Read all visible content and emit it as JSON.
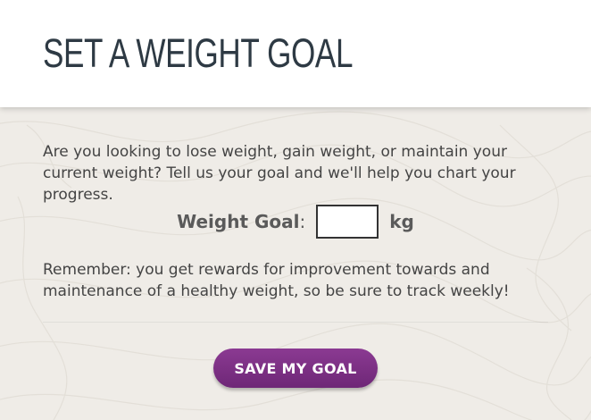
{
  "page": {
    "title": "SET A WEIGHT GOAL"
  },
  "main": {
    "intro_text": "Are you looking to lose weight, gain weight, or maintain your current weight? Tell us your goal and we'll help you chart your progress.",
    "goal_label": "Weight Goal",
    "goal_colon": ":",
    "goal_value": "",
    "goal_placeholder": "",
    "goal_unit": "kg",
    "remember_text": "Remember: you get rewards for improvement towards and maintenance of a healthy weight, so be sure to track weekly!",
    "save_label": "SAVE MY GOAL"
  },
  "colors": {
    "title": "#2e3a44",
    "body_text": "#444444",
    "background": "#efece7",
    "button": "#7b2f84"
  }
}
